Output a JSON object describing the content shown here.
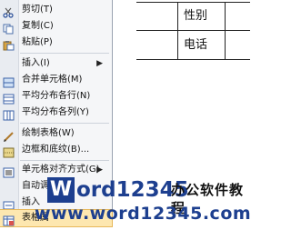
{
  "table": {
    "cells": [
      "性别",
      "电话"
    ]
  },
  "menu": {
    "items": [
      {
        "label": "剪切(T)",
        "icon": "scissors-icon"
      },
      {
        "label": "复制(C)",
        "icon": "copy-icon"
      },
      {
        "label": "粘贴(P)",
        "icon": "paste-icon"
      },
      {
        "label": "插入(I)",
        "icon": "",
        "arrow": "▶"
      },
      {
        "label": "合并单元格(M)",
        "icon": "merge-cells-icon"
      },
      {
        "label": "平均分布各行(N)",
        "icon": "distribute-rows-icon"
      },
      {
        "label": "平均分布各列(Y)",
        "icon": "distribute-columns-icon"
      },
      {
        "label": "绘制表格(W)",
        "icon": "draw-table-icon"
      },
      {
        "label": "边框和底纹(B)...",
        "icon": "borders-shading-icon"
      },
      {
        "label": "单元格对齐方式(G)",
        "icon": "cell-alignment-icon",
        "arrow": "▶"
      },
      {
        "label": "自动调",
        "icon": "",
        "arrow": "▶"
      },
      {
        "label": "插入",
        "icon": "insert-icon"
      },
      {
        "label": "表格属",
        "icon": "table-properties-icon"
      }
    ]
  },
  "watermark": {
    "brand_first": "W",
    "brand_rest": "ord12345",
    "tagline": "办公软件教程",
    "url": "www.word12345.com"
  },
  "colors": {
    "menu_bg": "#f5f6f8",
    "gutter": "#e9ecf1",
    "highlight": "#fde7b0",
    "brand": "#1d3f8f"
  }
}
